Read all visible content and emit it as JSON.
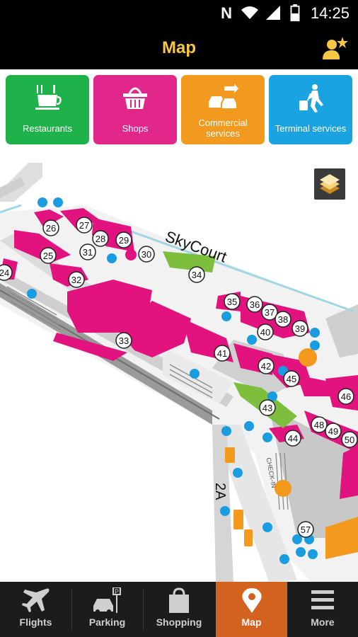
{
  "status_bar": {
    "time": "14:25",
    "icons": [
      "nfc-icon",
      "wifi-icon",
      "signal-icon",
      "battery-icon"
    ]
  },
  "header": {
    "title": "Map",
    "favorite_icon": "user-star-icon"
  },
  "categories": [
    {
      "label": "Restaurants",
      "icon": "coffee-cup-icon",
      "color": "#1fb14a"
    },
    {
      "label": "Shops",
      "icon": "basket-icon",
      "color": "#e2278b"
    },
    {
      "label": "Commercial services",
      "line1": "Commercial",
      "line2": "services",
      "icon": "car-rental-icon",
      "color": "#f29a1f"
    },
    {
      "label": "Terminal services",
      "icon": "traveler-icon",
      "color": "#1aa3e0"
    }
  ],
  "map": {
    "area_label": "SkyCourt",
    "terminal_label": "2A",
    "checkin_label": "CHECK-IN",
    "layers_icon": "layers-icon",
    "pins": [
      "24",
      "25",
      "26",
      "27",
      "28",
      "29",
      "30",
      "31",
      "32",
      "33",
      "34",
      "35",
      "36",
      "37",
      "38",
      "39",
      "40",
      "41",
      "42",
      "43",
      "44",
      "45",
      "46",
      "48",
      "49",
      "50",
      "57"
    ],
    "colors": {
      "shop": "#e2127f",
      "restaurant": "#7dbf3c",
      "service": "#f39a1e",
      "info": "#1a9ce0"
    }
  },
  "tabs": [
    {
      "label": "Flights",
      "icon": "airplane-icon",
      "active": false
    },
    {
      "label": "Parking",
      "icon": "parking-car-icon",
      "active": false
    },
    {
      "label": "Shopping",
      "icon": "shopping-bag-icon",
      "active": false
    },
    {
      "label": "Map",
      "icon": "map-pin-icon",
      "active": true
    },
    {
      "label": "More",
      "icon": "hamburger-menu-icon",
      "active": false
    }
  ],
  "accent": "#d4621f"
}
